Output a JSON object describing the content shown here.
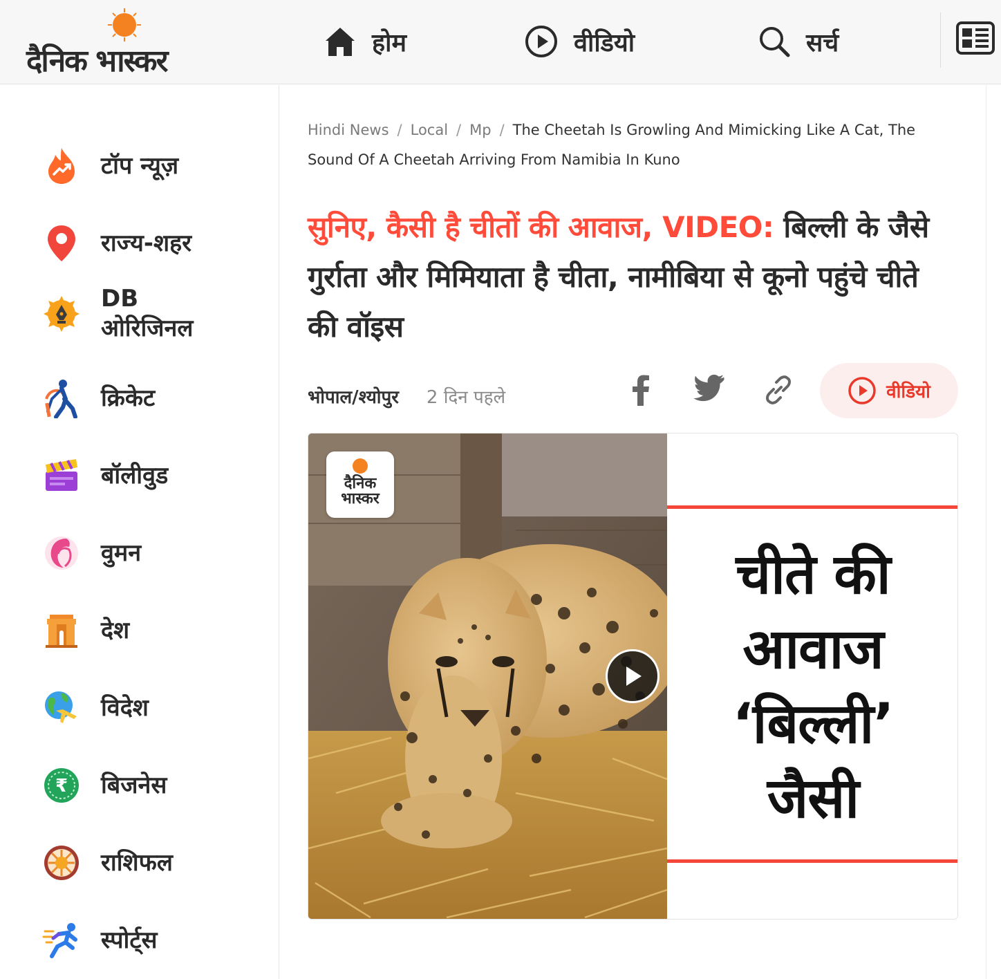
{
  "header": {
    "logo_text": "दैनिक भास्कर",
    "nav": [
      {
        "label": "होम",
        "icon": "home-icon"
      },
      {
        "label": "वीडियो",
        "icon": "play-circle-icon"
      },
      {
        "label": "सर्च",
        "icon": "search-icon"
      }
    ],
    "epaper_icon": "newspaper-icon"
  },
  "sidebar": {
    "items": [
      {
        "label": "टॉप न्यूज़",
        "icon": "fire-trend-icon"
      },
      {
        "label": "राज्य-शहर",
        "icon": "location-pin-icon"
      },
      {
        "label": "DB ओरिजिनल",
        "icon": "pen-nib-badge-icon"
      },
      {
        "label": "क्रिकेट",
        "icon": "cricket-batsman-icon"
      },
      {
        "label": "बॉलीवुड",
        "icon": "clapperboard-icon"
      },
      {
        "label": "वुमन",
        "icon": "woman-face-icon"
      },
      {
        "label": "देश",
        "icon": "india-gate-icon"
      },
      {
        "label": "विदेश",
        "icon": "globe-plane-icon"
      },
      {
        "label": "बिजनेस",
        "icon": "rupee-coin-icon"
      },
      {
        "label": "राशिफल",
        "icon": "zodiac-sun-icon"
      },
      {
        "label": "स्पोर्ट्स",
        "icon": "runner-icon"
      }
    ]
  },
  "article": {
    "breadcrumb": [
      "Hindi News",
      "Local",
      "Mp",
      "The Cheetah Is Growling And Mimicking Like A Cat, The Sound Of A Cheetah Arriving From Namibia In Kuno"
    ],
    "headline_highlight": "सुनिए, कैसी है चीतों की आवाज, VIDEO:",
    "headline_rest": " बिल्ली के जैसे गुर्राता और मिमियाता है चीता, नामीबिया से कूनो पहुंचे चीते की वॉइस",
    "location": "भोपाल/श्योपुर",
    "time": "2 दिन पहले",
    "video_button_label": "वीडियो",
    "media": {
      "watermark": "दैनिक भास्कर",
      "caption_lines": [
        "चीते की",
        "आवाज",
        "‘बिल्ली’",
        "जैसी"
      ]
    }
  },
  "colors": {
    "accent_red": "#ff4b3a",
    "logo_orange": "#f58220",
    "video_pill_bg": "#fdeeee"
  }
}
